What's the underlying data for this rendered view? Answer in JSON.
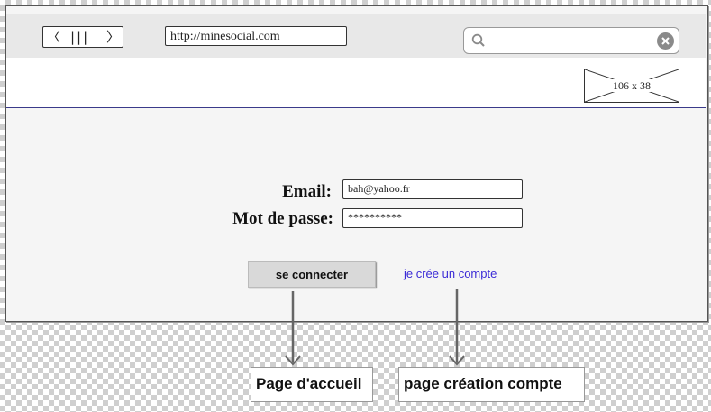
{
  "browser": {
    "url": "http://minesocial.com",
    "search_value": "",
    "nav_back_glyph": "〈",
    "nav_mid_glyph": "|||",
    "nav_forward_glyph": "〉"
  },
  "header": {
    "image_placeholder_label": "106 x 38"
  },
  "login": {
    "email_label": "Email:",
    "email_value": "bah@yahoo.fr",
    "password_label": "Mot de passe:",
    "password_value": "**********",
    "submit_label": "se connecter",
    "create_account_link": "je crée un compte"
  },
  "annotations": {
    "home_page": "Page d'accueil",
    "account_creation_page": "page création compte"
  },
  "colors": {
    "frame_border": "#3a3a8a",
    "link": "#3b2bd6",
    "button_bg": "#d9d9d9"
  },
  "icons": [
    "search-icon",
    "clear-icon",
    "image-placeholder-icon",
    "arrow-down-icon"
  ]
}
